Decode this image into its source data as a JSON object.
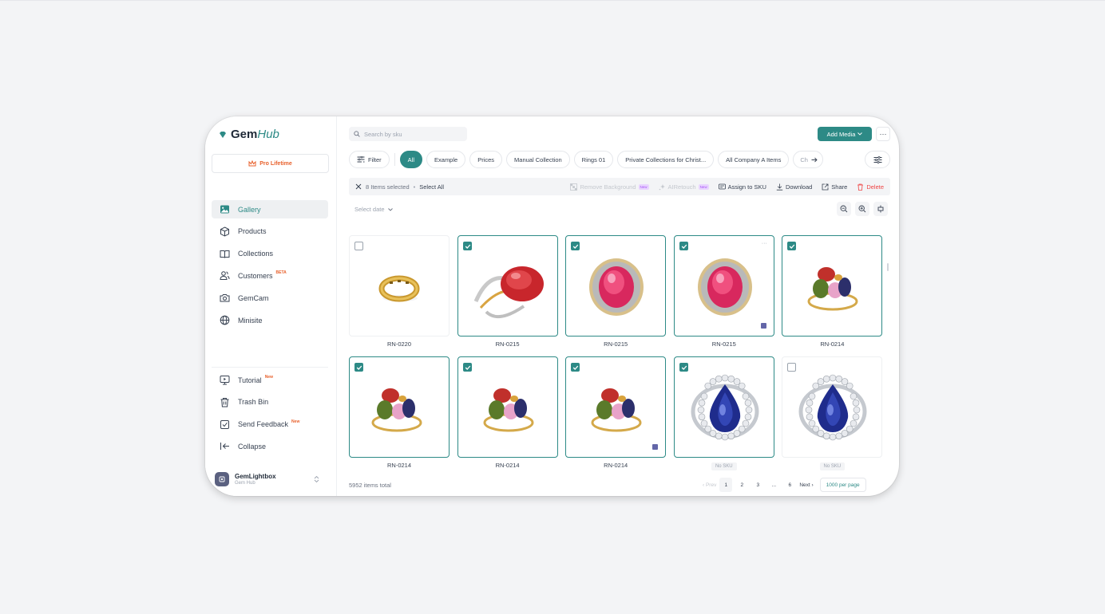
{
  "app": {
    "logo_gem": "Gem",
    "logo_hub": "Hub",
    "pro_label": "Pro Lifetime"
  },
  "sidebar": {
    "items": [
      {
        "label": "Gallery",
        "icon": "image-icon",
        "active": true
      },
      {
        "label": "Products",
        "icon": "box-icon"
      },
      {
        "label": "Collections",
        "icon": "book-icon"
      },
      {
        "label": "Customers",
        "icon": "users-icon",
        "tag": "BETA"
      },
      {
        "label": "GemCam",
        "icon": "camera-icon"
      },
      {
        "label": "Minisite",
        "icon": "globe-icon"
      }
    ],
    "bottom_items": [
      {
        "label": "Tutorial",
        "icon": "play-icon",
        "tag": "New"
      },
      {
        "label": "Trash Bin",
        "icon": "trash-icon"
      },
      {
        "label": "Send Feedback",
        "icon": "feedback-icon",
        "tag": "New"
      },
      {
        "label": "Collapse",
        "icon": "collapse-icon"
      }
    ],
    "account": {
      "name": "GemLightbox",
      "sub": "Gem Hub"
    }
  },
  "header": {
    "search_placeholder": "Search by sku",
    "add_media": "Add Media"
  },
  "chips": {
    "filter": "Filter",
    "items": [
      "All",
      "Example",
      "Prices",
      "Manual Collection",
      "Rings 01",
      "Private Collections for Christ...",
      "All Company A Items"
    ],
    "overflow": "Ch"
  },
  "selection": {
    "count": "8 Items selected",
    "select_all": "Select All",
    "remove_bg": "Remove Background",
    "airetouch": "AIRetouch",
    "assign": "Assign to SKU",
    "download": "Download",
    "share": "Share",
    "delete": "Delete"
  },
  "date_select": "Select date",
  "gallery": {
    "items": [
      {
        "sku": "RN-0220",
        "selected": false,
        "kind": "band"
      },
      {
        "sku": "RN-0215",
        "selected": true,
        "kind": "ruby-side"
      },
      {
        "sku": "RN-0215",
        "selected": true,
        "kind": "ruby-top"
      },
      {
        "sku": "RN-0215",
        "selected": true,
        "kind": "ruby-top",
        "more": "···",
        "badge": true
      },
      {
        "sku": "RN-0214",
        "selected": true,
        "kind": "cluster"
      },
      {
        "sku": "RN-0214",
        "selected": true,
        "kind": "cluster-side"
      },
      {
        "sku": "RN-0214",
        "selected": true,
        "kind": "cluster"
      },
      {
        "sku": "RN-0214",
        "selected": true,
        "kind": "cluster",
        "badge": true
      },
      {
        "sku": "No SKU",
        "selected": true,
        "kind": "sapphire",
        "nosku": true
      },
      {
        "sku": "No SKU",
        "selected": false,
        "kind": "sapphire",
        "nosku": true
      }
    ]
  },
  "footer": {
    "total": "5952 items total",
    "prev": "‹ Prev",
    "pages": [
      "1",
      "2",
      "3",
      "...",
      "6"
    ],
    "next": "Next ›",
    "per_page": "1000 per page"
  }
}
